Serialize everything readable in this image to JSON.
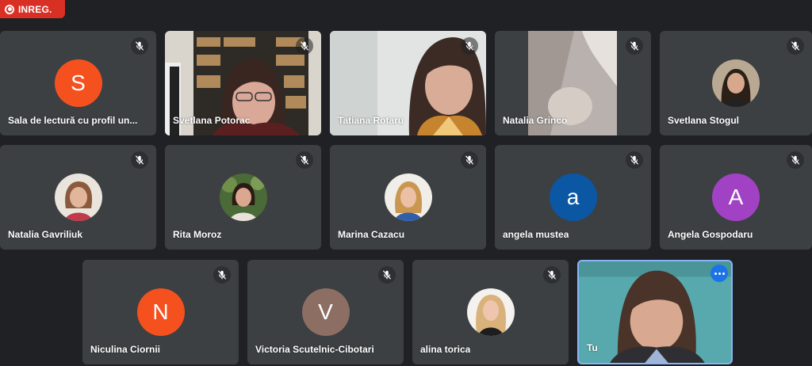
{
  "recording": {
    "label": "INREG."
  },
  "colors": {
    "background": "#202124",
    "tile": "#3c4043",
    "record_red": "#d93025",
    "self_border": "#8ab4f8",
    "more_button": "#1a73e8"
  },
  "participants": [
    {
      "name": "Sala de lectură cu profil un...",
      "kind": "letter",
      "letter": "S",
      "color": "#f4511e",
      "muted": true
    },
    {
      "name": "Svetlana Potorac",
      "kind": "video",
      "muted": true
    },
    {
      "name": "Tatiana Rotaru",
      "kind": "video",
      "muted": true
    },
    {
      "name": "Natalia Grinco",
      "kind": "video",
      "muted": true
    },
    {
      "name": "Svetlana Stogul",
      "kind": "photo",
      "muted": true
    },
    {
      "name": "Natalia Gavriliuk",
      "kind": "photo",
      "muted": true
    },
    {
      "name": "Rita Moroz",
      "kind": "photo",
      "muted": true
    },
    {
      "name": "Marina Cazacu",
      "kind": "photo",
      "muted": true
    },
    {
      "name": "angela mustea",
      "kind": "letter",
      "letter": "a",
      "color": "#0b57a4",
      "muted": true
    },
    {
      "name": "Angela Gospodaru",
      "kind": "letter",
      "letter": "A",
      "color": "#a142c4",
      "muted": true
    },
    {
      "name": "Niculina Ciornii",
      "kind": "letter",
      "letter": "N",
      "color": "#f4511e",
      "muted": true
    },
    {
      "name": "Victoria Scutelnic-Cibotari",
      "kind": "letter",
      "letter": "V",
      "color": "#8d6e63",
      "muted": true
    },
    {
      "name": "alina torica",
      "kind": "photo",
      "muted": true
    },
    {
      "name": "Tu",
      "kind": "video",
      "self": true
    }
  ],
  "letters": {
    "p0": "S",
    "p8": "a",
    "p9": "A",
    "p10": "N",
    "p11": "V"
  },
  "names": {
    "p0": "Sala de lectură cu profil un...",
    "p1": "Svetlana Potorac",
    "p2": "Tatiana Rotaru",
    "p3": "Natalia Grinco",
    "p4": "Svetlana Stogul",
    "p5": "Natalia Gavriliuk",
    "p6": "Rita Moroz",
    "p7": "Marina Cazacu",
    "p8": "angela mustea",
    "p9": "Angela Gospodaru",
    "p10": "Niculina Ciornii",
    "p11": "Victoria Scutelnic-Cibotari",
    "p12": "alina torica",
    "p13": "Tu"
  }
}
